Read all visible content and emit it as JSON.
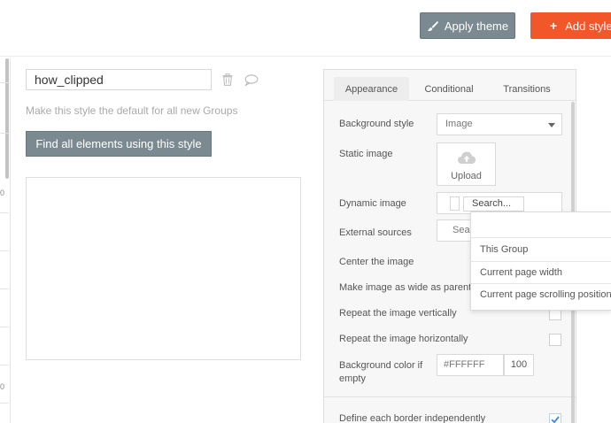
{
  "toolbar": {
    "apply_theme_label": "Apply theme",
    "add_style_label": "Add style"
  },
  "left_strip": {
    "digits": [
      "0",
      "0"
    ]
  },
  "style_editor": {
    "name_value": "how_clipped",
    "default_hint": "Make this style the default for all new Groups",
    "find_button_label": "Find all elements using this style"
  },
  "panel": {
    "tabs": [
      {
        "label": "Appearance",
        "active": true
      },
      {
        "label": "Conditional",
        "active": false
      },
      {
        "label": "Transitions",
        "active": false
      }
    ],
    "background_style_label": "Background style",
    "background_style_value": "Image",
    "static_image_label": "Static image",
    "upload_label": "Upload",
    "dynamic_image_label": "Dynamic image",
    "dynamic_search_placeholder": "Search...",
    "external_sources_label": "External sources",
    "external_sources_value": "Sear",
    "center_image_label": "Center the image",
    "wide_image_label": "Make image as wide as parent e",
    "repeat_vertical_label": "Repeat the image vertically",
    "repeat_horizontal_label": "Repeat the image horizontally",
    "bg_color_label_line1": "Background color if",
    "bg_color_label_line2": "empty",
    "bg_color_value": "#FFFFFF",
    "bg_opacity_value": "100",
    "border_label": "Define each border independently"
  },
  "dropdown": {
    "items": [
      "This Group",
      "Current page width",
      "Current page scrolling position"
    ]
  },
  "colors": {
    "accent_orange": "#f2572a",
    "button_gray": "#7b8a91",
    "check_blue": "#3a8ad8"
  }
}
